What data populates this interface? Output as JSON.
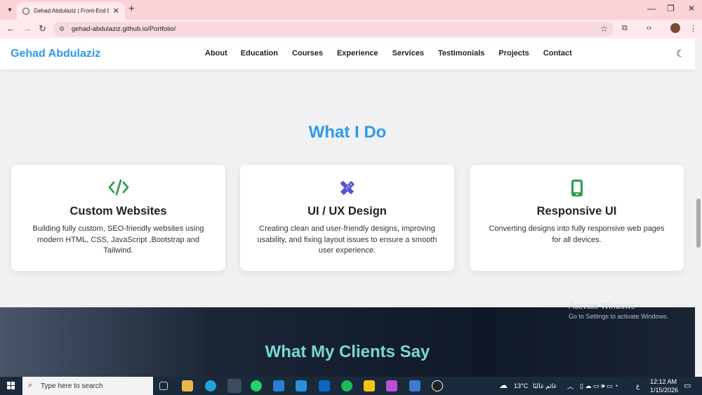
{
  "browser": {
    "tab_title": "Gehad Abdulaziz | Front-End D",
    "url": "gehad-abdulaziz.github.io/Portfolio/"
  },
  "site": {
    "brand": "Gehad Abdulaziz",
    "menu": [
      "About",
      "Education",
      "Courses",
      "Experience",
      "Services",
      "Testimonials",
      "Projects",
      "Contact"
    ]
  },
  "what_i_do": {
    "title": "What I Do",
    "cards": [
      {
        "icon": "code-icon",
        "title": "Custom Websites",
        "desc": "Building fully custom, SEO-friendly websites using modern HTML, CSS, JavaScript ,Bootstrap and Tailwind."
      },
      {
        "icon": "pencil-ruler-icon",
        "title": "UI / UX Design",
        "desc": "Creating clean and user-friendly designs, improving usability, and fixing layout issues to ensure a smooth user experience."
      },
      {
        "icon": "mobile-icon",
        "title": "Responsive UI",
        "desc": "Converting designs into fully responsive web pages for all devices."
      }
    ]
  },
  "clients": {
    "title": "What My Clients Say"
  },
  "watermark": {
    "line1": "Activate Windows",
    "line2": "Go to Settings to activate Windows."
  },
  "taskbar": {
    "search_placeholder": "Type here to search",
    "weather": "13°C",
    "weather_text": "غائم غالبًا",
    "lang": "ع",
    "time": "12:12 AM",
    "date": "1/15/2026"
  },
  "colors": {
    "accent": "#2d9bea",
    "icon_green": "#2e9e4a",
    "icon_purple": "#5b54d6",
    "teal": "#78d7d3"
  }
}
